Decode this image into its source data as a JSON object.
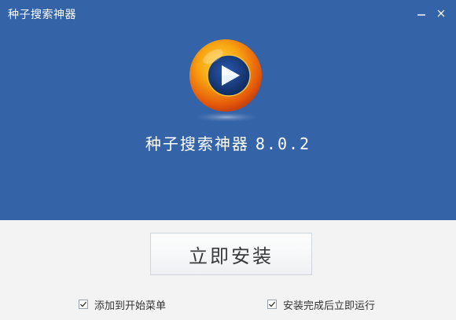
{
  "window": {
    "title": "种子搜索神器",
    "controls": {
      "minimize_icon": "minimize-icon",
      "close_icon": "close-icon"
    }
  },
  "hero": {
    "logo_icon": "play-logo-icon",
    "app_name": "种子搜索神器",
    "version": "8.0.2"
  },
  "install": {
    "button_label": "立即安装"
  },
  "options": [
    {
      "label": "添加到开始菜单",
      "checked": true
    },
    {
      "label": "安装完成后立即运行",
      "checked": true
    }
  ],
  "colors": {
    "header_bg": "#3463a8",
    "footer_bg": "#f3f3f3",
    "logo_orange": "#f5a20a",
    "logo_inner": "#1c3f84"
  }
}
